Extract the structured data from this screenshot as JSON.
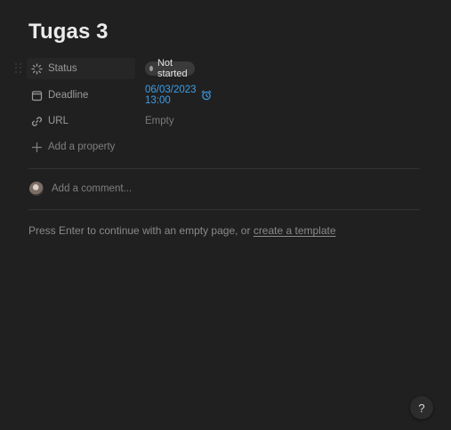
{
  "page": {
    "title": "Tugas 3"
  },
  "properties": [
    {
      "name": "Status",
      "icon": "status-spinner-icon",
      "value": "Not started"
    },
    {
      "name": "Deadline",
      "icon": "calendar-icon",
      "value": "06/03/2023 13:00",
      "reminder_icon": "alarm-clock-icon"
    },
    {
      "name": "URL",
      "icon": "link-icon",
      "value": "Empty"
    }
  ],
  "add_property": {
    "label": "Add a property",
    "icon": "plus-icon"
  },
  "comment": {
    "placeholder": "Add a comment..."
  },
  "hint": {
    "text": "Press Enter to continue with an empty page, or ",
    "link": "create a template"
  },
  "help": {
    "label": "?"
  },
  "colors": {
    "background": "#202020",
    "date_link": "#3c9ee8",
    "status_pill": "#3a3a3a"
  }
}
